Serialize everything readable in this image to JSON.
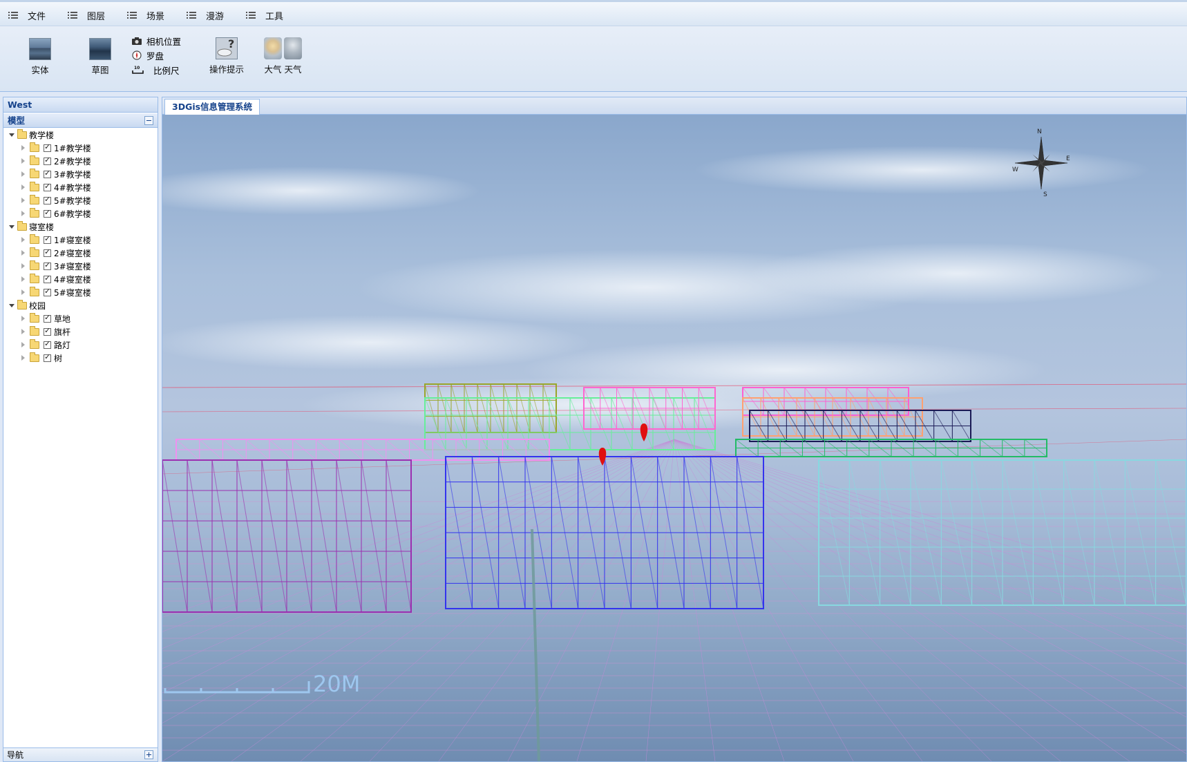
{
  "menu": [
    {
      "label": "文件",
      "icon": "list-icon"
    },
    {
      "label": "图层",
      "icon": "list-icon"
    },
    {
      "label": "场景",
      "icon": "list-icon"
    },
    {
      "label": "漫游",
      "icon": "list-icon"
    },
    {
      "label": "工具",
      "icon": "list-icon"
    }
  ],
  "toolbar": {
    "solid_label": "实体",
    "sketch_label": "草图",
    "camera_position_label": "相机位置",
    "compass_label": "罗盘",
    "scale_label": "比例尺",
    "scale_icon_text": "10",
    "help_label": "操作提示",
    "atmosphere_label": "大气",
    "weather_label": "天气"
  },
  "west": {
    "title": "West",
    "model_panel_title": "模型",
    "nav_panel_title": "导航",
    "tree": [
      {
        "label": "教学楼",
        "children": [
          "1#教学楼",
          "2#教学楼",
          "3#教学楼",
          "4#教学楼",
          "5#教学楼",
          "6#教学楼"
        ]
      },
      {
        "label": "寝室楼",
        "children": [
          "1#寝室楼",
          "2#寝室楼",
          "3#寝室楼",
          "4#寝室楼",
          "5#寝室楼"
        ]
      },
      {
        "label": "校园",
        "children": [
          "草地",
          "旗杆",
          "路灯",
          "树"
        ]
      }
    ]
  },
  "center": {
    "tab_title": "3DGis信息管理系统",
    "compass": {
      "n": "N",
      "e": "E",
      "s": "S",
      "w": "W"
    },
    "scale_text": "20M"
  },
  "colors": {
    "header_text": "#15428b",
    "panel_border": "#99bbe8",
    "marker": "#e01010"
  }
}
